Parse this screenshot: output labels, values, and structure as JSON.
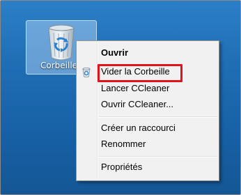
{
  "desktop": {
    "icon_label": "Corbeille",
    "icon_name": "recycle-bin-icon"
  },
  "context_menu": {
    "items": [
      {
        "label": "Ouvrir",
        "bold": true
      },
      {
        "label": "Vider la Corbeille",
        "highlighted": true,
        "icon": "recycle-bin-small-icon"
      },
      {
        "label": "Lancer CCleaner"
      },
      {
        "label": "Ouvrir CCleaner..."
      },
      {
        "label": "Créer un raccourci"
      },
      {
        "label": "Renommer"
      },
      {
        "label": "Propriétés"
      }
    ]
  },
  "colors": {
    "desktop_background": "#1f6db4",
    "highlight_border": "#e0151c",
    "menu_background": "#f1f1f1"
  }
}
